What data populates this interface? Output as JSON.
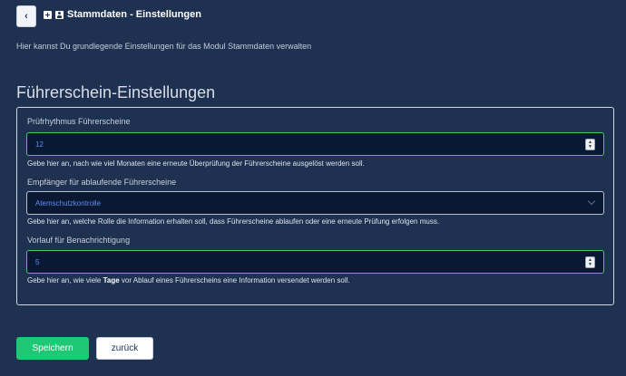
{
  "header": {
    "back_icon": "‹",
    "title": "Stammdaten - Einstellungen",
    "icons": [
      "plus-square-icon",
      "user-card-icon"
    ]
  },
  "subtitle": "Hier kannst Du grundlegende Einstellungen für das Modul Stammdaten verwalten",
  "section_title": "Führerschein-Einstellungen",
  "fields": [
    {
      "label": "Prüfrhythmus Führerscheine",
      "value": "12",
      "help": "Gebe hier an, nach wie viel Monaten eine erneute Überprüfung der Führerscheine ausgelöst werden soll."
    },
    {
      "label": "Empfänger für ablaufende Führerscheine",
      "value": "Atemschutzkontrolle",
      "help": "Gebe hier an, welche Rolle die Information erhalten soll, dass Führerscheine ablaufen oder eine erneute Prüfung erfolgen muss."
    },
    {
      "label": "Vorlauf für Benachrichtigung",
      "value": "5",
      "help_before": "Gebe hier an, wie viele ",
      "help_bold": "Tage",
      "help_after": " vor Ablauf eines Führerscheins eine Information versendet werden soll."
    }
  ],
  "buttons": {
    "save": "Speichern",
    "back": "zurück"
  },
  "colors": {
    "background": "#1f3151",
    "input_bg": "#0a1833",
    "focus_border": "#52c27a",
    "save_button": "#1ec875",
    "value_text": "#5d8ff0"
  }
}
